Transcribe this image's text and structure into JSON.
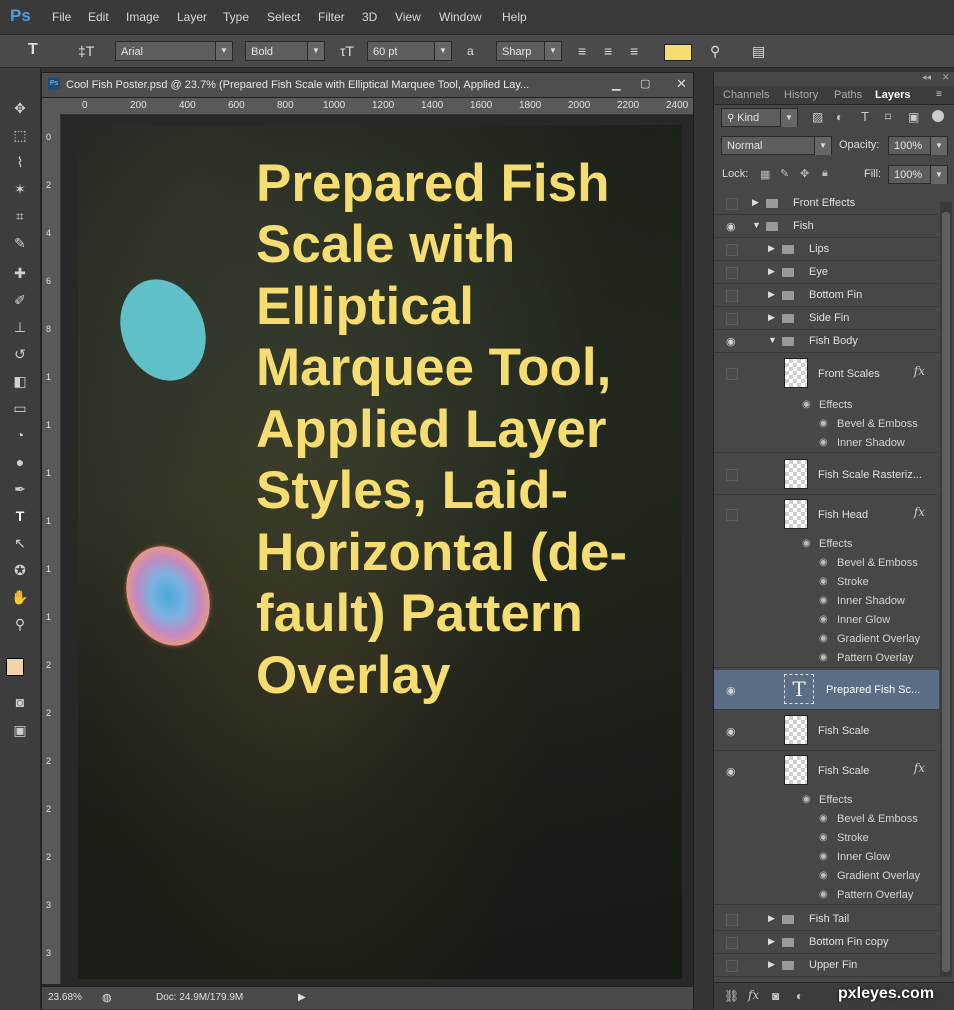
{
  "menu": {
    "logo": "Ps",
    "items": [
      "File",
      "Edit",
      "Image",
      "Layer",
      "Type",
      "Select",
      "Filter",
      "3D",
      "View",
      "Window",
      "Help"
    ]
  },
  "options": {
    "font_family": "Arial",
    "font_style": "Bold",
    "font_size": "60 pt",
    "aa_label": "a",
    "antialias": "Sharp",
    "text_color": "#f6dd72"
  },
  "document": {
    "title": "Cool Fish Poster.psd @ 23.7% (Prepared Fish Scale with Elliptical Marquee Tool, Applied Lay...",
    "ruler_h": [
      "0",
      "200",
      "400",
      "600",
      "800",
      "1000",
      "1200",
      "1400",
      "1600",
      "1800",
      "2000",
      "2200",
      "2400"
    ],
    "ruler_v": [
      "0",
      "2",
      "4",
      "6",
      "8",
      "1",
      "1",
      "1",
      "1",
      "1",
      "1",
      "2",
      "2",
      "2",
      "2",
      "2",
      "3",
      "3"
    ],
    "poster_text": "Prepared Fish Scale with Elliptical Marquee Tool, Applied Layer Styles, Laid-Horizontal (de-fault) Pattern Overlay",
    "zoom": "23.68%",
    "doc_info": "Doc: 24.9M/179.9M"
  },
  "panel": {
    "tabs": [
      "Channels",
      "History",
      "Paths",
      "Layers"
    ],
    "filter_kind": "Kind",
    "blend_mode": "Normal",
    "opacity_label": "Opacity:",
    "opacity_value": "100%",
    "lock_label": "Lock:",
    "fill_label": "Fill:",
    "fill_value": "100%",
    "effects_label": "Effects",
    "layers": {
      "front_effects": "Front Effects",
      "fish": "Fish",
      "lips": "Lips",
      "eye": "Eye",
      "bottom_fin": "Bottom Fin",
      "side_fin": "Side Fin",
      "fish_body": "Fish Body",
      "front_scales": "Front Scales",
      "fish_scale_raster": "Fish Scale Rasteriz...",
      "fish_head": "Fish Head",
      "prepared_text": "Prepared Fish Sc...",
      "fish_scale_1": "Fish Scale",
      "fish_scale_2": "Fish Scale",
      "fish_tail": "Fish Tail",
      "bottom_fin_copy": "Bottom Fin copy",
      "upper_fin": "Upper Fin"
    },
    "fx": {
      "front_scales": [
        "Bevel & Emboss",
        "Inner Shadow"
      ],
      "fish_head": [
        "Bevel & Emboss",
        "Stroke",
        "Inner Shadow",
        "Inner Glow",
        "Gradient Overlay",
        "Pattern Overlay"
      ],
      "fish_scale_2": [
        "Bevel & Emboss",
        "Stroke",
        "Inner Glow",
        "Gradient Overlay",
        "Pattern Overlay"
      ]
    }
  },
  "watermark": "pxleyes.com"
}
